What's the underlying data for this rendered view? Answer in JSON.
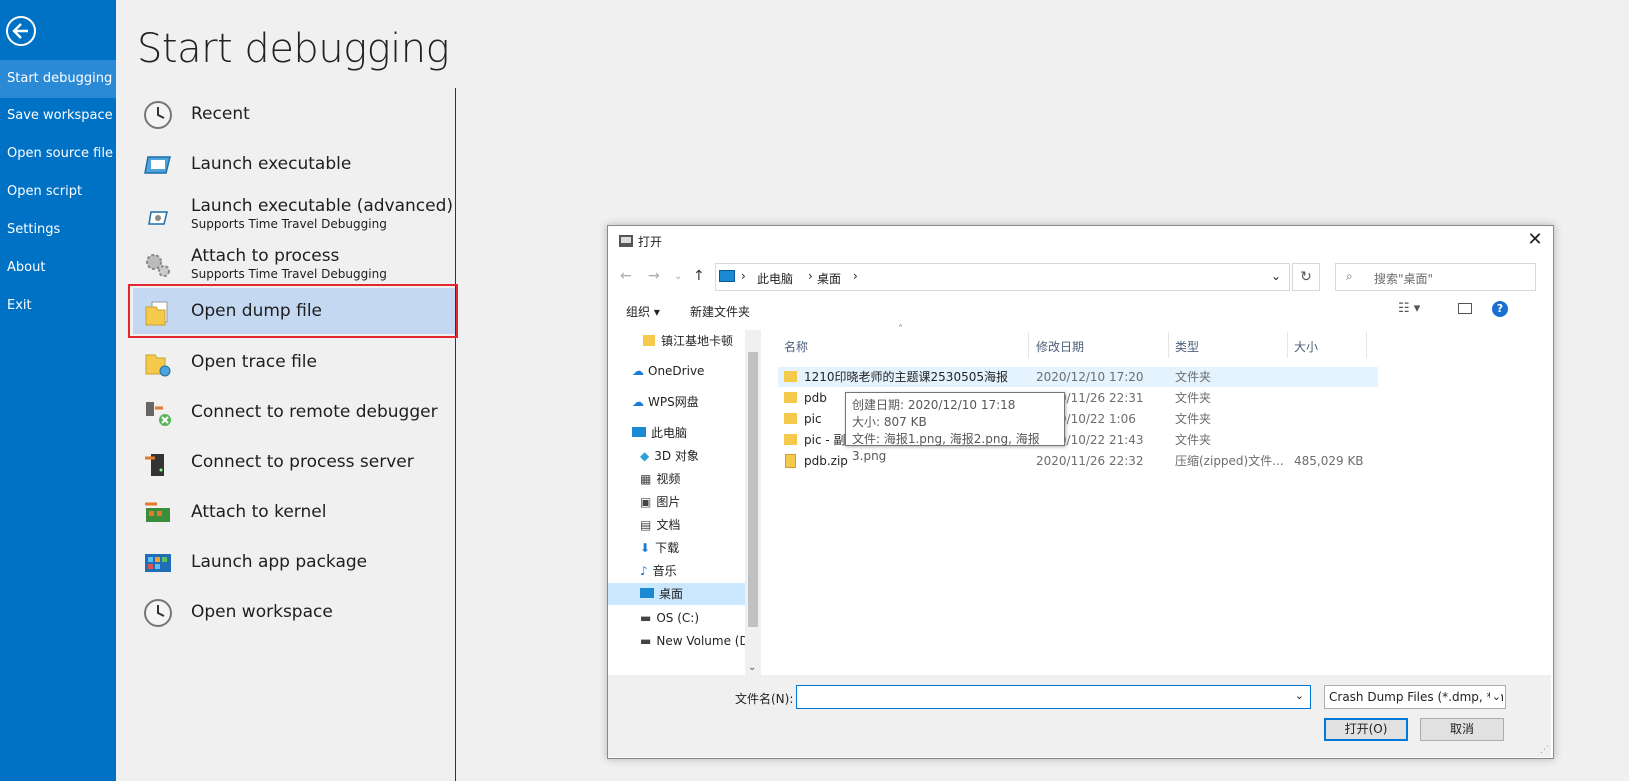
{
  "nav": {
    "items": [
      "Start debugging",
      "Save workspace",
      "Open source file",
      "Open script",
      "Settings",
      "About",
      "Exit"
    ]
  },
  "main": {
    "title": "Start debugging",
    "items": [
      {
        "label": "Recent",
        "sub": "",
        "icon": "clock-icon"
      },
      {
        "label": "Launch executable",
        "sub": "",
        "icon": "executable-icon"
      },
      {
        "label": "Launch executable (advanced)",
        "sub": "Supports Time Travel Debugging",
        "icon": "executable-advanced-icon"
      },
      {
        "label": "Attach to process",
        "sub": "Supports Time Travel Debugging",
        "icon": "gears-icon"
      },
      {
        "label": "Open dump file",
        "sub": "",
        "icon": "dump-file-icon"
      },
      {
        "label": "Open trace file",
        "sub": "",
        "icon": "trace-file-icon"
      },
      {
        "label": "Connect to remote debugger",
        "sub": "",
        "icon": "remote-debugger-icon"
      },
      {
        "label": "Connect to process server",
        "sub": "",
        "icon": "process-server-icon"
      },
      {
        "label": "Attach to kernel",
        "sub": "",
        "icon": "kernel-icon"
      },
      {
        "label": "Launch app package",
        "sub": "",
        "icon": "app-package-icon"
      },
      {
        "label": "Open workspace",
        "sub": "",
        "icon": "clock-icon"
      }
    ]
  },
  "dialog": {
    "title": "打开",
    "breadcrumb": [
      "此电脑",
      "桌面"
    ],
    "search_placeholder": "搜索\"桌面\"",
    "organize": "组织 ▾",
    "new_folder": "新建文件夹",
    "tree": [
      "镇江基地卡顿",
      "OneDrive",
      "WPS网盘",
      "此电脑",
      "3D 对象",
      "视频",
      "图片",
      "文档",
      "下载",
      "音乐",
      "桌面",
      "OS (C:)",
      "New Volume (D"
    ],
    "columns": [
      "名称",
      "修改日期",
      "类型",
      "大小"
    ],
    "files": [
      {
        "name": "1210印晓老师的主题课2530505海报",
        "date": "2020/12/10 17:20",
        "type": "文件夹",
        "size": ""
      },
      {
        "name": "pdb",
        "date": "2020/11/26 22:31",
        "type": "文件夹",
        "size": ""
      },
      {
        "name": "pic",
        "date": "2020/10/22 1:06",
        "type": "文件夹",
        "size": ""
      },
      {
        "name": "pic - 副",
        "date": "2020/10/22 21:43",
        "type": "文件夹",
        "size": ""
      },
      {
        "name": "pdb.zip",
        "date": "2020/11/26 22:32",
        "type": "压缩(zipped)文件...",
        "size": "485,029 KB"
      }
    ],
    "tooltip": [
      "创建日期: 2020/12/10 17:18",
      "大小: 807 KB",
      "文件: 海报1.png, 海报2.png, 海报3.png"
    ],
    "filename_label": "文件名(N):",
    "filename_value": "",
    "filetype": "Crash Dump Files (*.dmp, *.h",
    "open_button": "打开(O)",
    "cancel_button": "取消"
  },
  "colors": {
    "nav": "#0072c6",
    "selected": "#c5d8f2",
    "highlight_box": "#e3262f"
  }
}
